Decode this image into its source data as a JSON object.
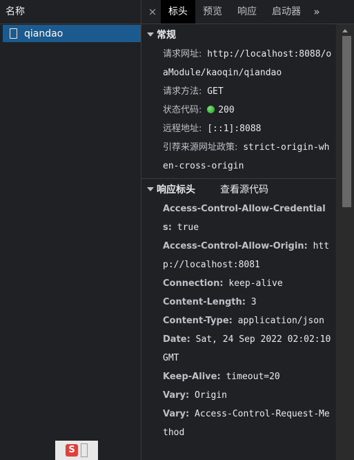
{
  "left_panel": {
    "header": "名称",
    "selected_request": "qiandao"
  },
  "tabs": {
    "close": "×",
    "items": [
      "标头",
      "预览",
      "响应",
      "启动器"
    ],
    "more": "»"
  },
  "general": {
    "title": "常规",
    "request_url": {
      "key": "请求网址:",
      "value": "http://localhost:8088/oaModule/kaoqin/qiandao"
    },
    "request_method": {
      "key": "请求方法:",
      "value": "GET"
    },
    "status_code": {
      "key": "状态代码:",
      "value": "200",
      "status_color": "#2ea043"
    },
    "remote_address": {
      "key": "远程地址:",
      "value": "[::1]:8088"
    },
    "referrer_policy": {
      "key": "引荐来源网址政策:",
      "value": "strict-origin-when-cross-origin"
    }
  },
  "response_headers": {
    "title": "响应标头",
    "view_source": "查看源代码",
    "items": [
      {
        "key": "Access-Control-Allow-Credentials:",
        "value": "true"
      },
      {
        "key": "Access-Control-Allow-Origin:",
        "value": "http://localhost:8081"
      },
      {
        "key": "Connection:",
        "value": "keep-alive"
      },
      {
        "key": "Content-Length:",
        "value": "3"
      },
      {
        "key": "Content-Type:",
        "value": "application/json"
      },
      {
        "key": "Date:",
        "value": "Sat, 24 Sep 2022 02:02:10 GMT"
      },
      {
        "key": "Keep-Alive:",
        "value": "timeout=20"
      },
      {
        "key": "Vary:",
        "value": "Origin"
      },
      {
        "key": "Vary:",
        "value": "Access-Control-Request-Method"
      }
    ]
  },
  "taskbar_icon": {
    "logo_text": "S",
    "name": "sogou-input-icon"
  },
  "colors": {
    "selected_row": "#1a5a8f",
    "background": "#202124",
    "active_tab": "#000000"
  }
}
